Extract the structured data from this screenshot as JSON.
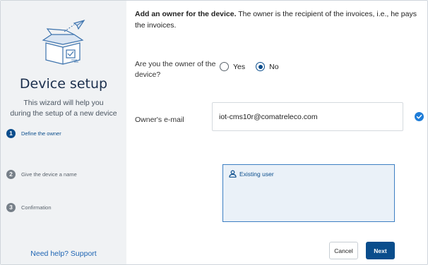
{
  "sidebar": {
    "hero_icon": "box-with-paper-plane-icon",
    "title": "Device setup",
    "subtitle_line1": "This wizard will help you",
    "subtitle_line2": "during the setup of a new device",
    "steps": [
      {
        "number": "1",
        "label": "Define the owner",
        "active": true
      },
      {
        "number": "2",
        "label": "Give the device a name",
        "active": false
      },
      {
        "number": "3",
        "label": "Confirmation",
        "active": false
      }
    ],
    "help_link": "Need help? Support"
  },
  "main": {
    "intro_bold": "Add an owner for the device.",
    "intro_rest": " The owner is the recipient of the invoices, i.e., he pays the invoices.",
    "owner_question": "Are you the owner of the device?",
    "radio_options": [
      {
        "label": "Yes",
        "selected": false
      },
      {
        "label": "No",
        "selected": true
      }
    ],
    "email_label": "Owner's e-mail",
    "email_value": "iot-cms10r@comatreleco.com",
    "email_valid_icon": "check-circle-icon",
    "user_status_icon": "user-icon",
    "user_status": "Existing user",
    "cancel_label": "Cancel",
    "next_label": "Next"
  },
  "colors": {
    "primary": "#0a4d8c",
    "link": "#1d64b3",
    "sidebar_bg": "#f0f2f4",
    "check": "#1f7dd8"
  }
}
